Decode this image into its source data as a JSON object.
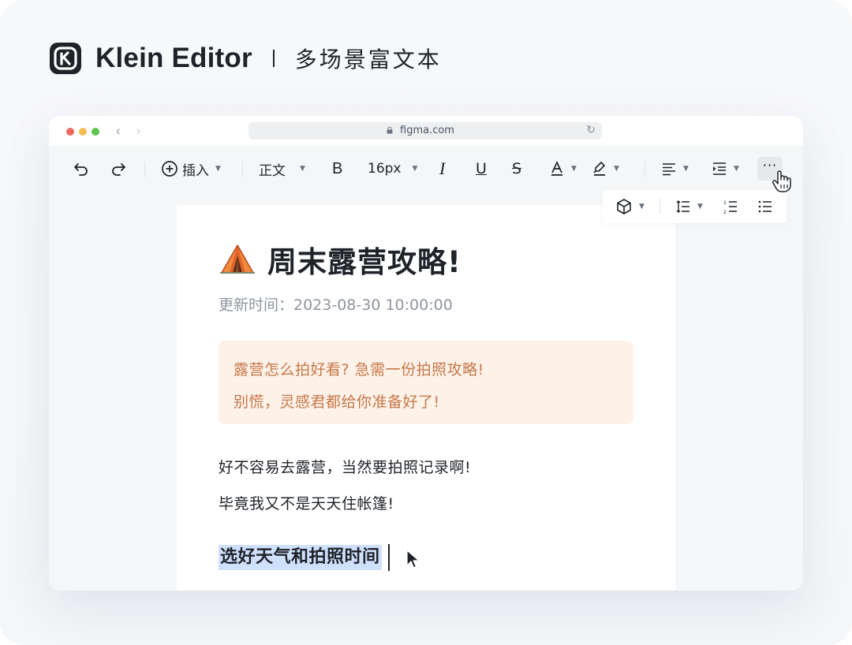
{
  "brand": {
    "name": "Klein Editor",
    "separator": "|",
    "tagline": "多场景富文本"
  },
  "browser": {
    "url": "figma.com"
  },
  "toolbar": {
    "insert_label": "插入",
    "paragraph_style": "正文",
    "font_size": "16px",
    "more_label": "···"
  },
  "document": {
    "title_emoji": "⛺",
    "title": "周末露营攻略!",
    "meta": "更新时间：2023-08-30 10:00:00",
    "callout": {
      "line1": "露营怎么拍好看? 急需一份拍照攻略!",
      "line2": "别慌，灵感君都给你准备好了!"
    },
    "paragraphs": [
      "好不容易去露营，当然要拍照记录啊!",
      "毕竟我又不是天天住帐篷!"
    ],
    "selected_heading": "选好天气和拍照时间"
  },
  "colors": {
    "accent_selection": "#cfe0fc",
    "callout_bg": "#fef1e8",
    "callout_text": "#c5794a"
  }
}
